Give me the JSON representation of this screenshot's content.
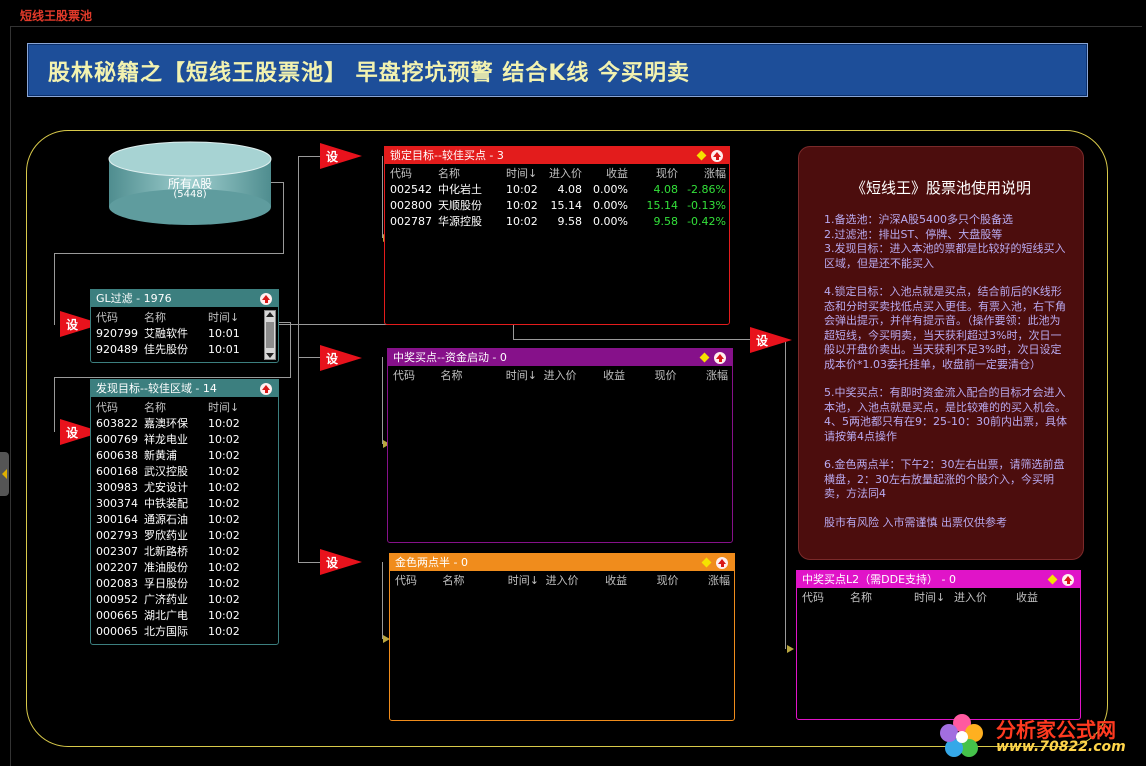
{
  "app": {
    "title": "短线王股票池"
  },
  "banner": {
    "title": "股林秘籍之【短线王股票池】 早盘挖坑预警 结合K线 今买明卖"
  },
  "flag_label": "设",
  "all_stocks": {
    "label": "所有A股",
    "count": "(5448)"
  },
  "gl_filter": {
    "title": "GL过滤 - 1976",
    "headers": [
      "代码",
      "名称",
      "时间↓"
    ],
    "rows": [
      {
        "code": "920799",
        "name": "艾融软件",
        "time": "10:01"
      },
      {
        "code": "920489",
        "name": "佳先股份",
        "time": "10:01"
      }
    ]
  },
  "discover": {
    "title": "发现目标--较佳区域 - 14",
    "headers": [
      "代码",
      "名称",
      "时间↓"
    ],
    "rows": [
      {
        "code": "603822",
        "name": "嘉澳环保",
        "time": "10:02"
      },
      {
        "code": "600769",
        "name": "祥龙电业",
        "time": "10:02"
      },
      {
        "code": "600638",
        "name": "新黄浦",
        "time": "10:02"
      },
      {
        "code": "600168",
        "name": "武汉控股",
        "time": "10:02"
      },
      {
        "code": "300983",
        "name": "尤安设计",
        "time": "10:02"
      },
      {
        "code": "300374",
        "name": "中铁装配",
        "time": "10:02"
      },
      {
        "code": "300164",
        "name": "通源石油",
        "time": "10:02"
      },
      {
        "code": "002793",
        "name": "罗欣药业",
        "time": "10:02"
      },
      {
        "code": "002307",
        "name": "北新路桥",
        "time": "10:02"
      },
      {
        "code": "002207",
        "name": "准油股份",
        "time": "10:02"
      },
      {
        "code": "002083",
        "name": "孚日股份",
        "time": "10:02"
      },
      {
        "code": "000952",
        "name": "广济药业",
        "time": "10:02"
      },
      {
        "code": "000665",
        "name": "湖北广电",
        "time": "10:02"
      },
      {
        "code": "000065",
        "name": "北方国际",
        "time": "10:02"
      }
    ]
  },
  "locked": {
    "title": "锁定目标--较佳买点 - 3",
    "headers": [
      "代码",
      "名称",
      "时间↓",
      "进入价",
      "收益",
      "现价",
      "涨幅"
    ],
    "rows": [
      {
        "code": "002542",
        "name": "中化岩土",
        "time": "10:02",
        "entry": "4.08",
        "gain": "0.00%",
        "price": "4.08",
        "chg": "-2.86%"
      },
      {
        "code": "002800",
        "name": "天顺股份",
        "time": "10:02",
        "entry": "15.14",
        "gain": "0.00%",
        "price": "15.14",
        "chg": "-0.13%"
      },
      {
        "code": "002787",
        "name": "华源控股",
        "time": "10:02",
        "entry": "9.58",
        "gain": "0.00%",
        "price": "9.58",
        "chg": "-0.42%"
      }
    ]
  },
  "mid_buy": {
    "title": "中奖买点--资金启动 - 0",
    "headers": [
      "代码",
      "名称",
      "时间↓",
      "进入价",
      "收益",
      "现价",
      "涨幅"
    ]
  },
  "golden": {
    "title": "金色两点半 - 0",
    "headers": [
      "代码",
      "名称",
      "时间↓",
      "进入价",
      "收益",
      "现价",
      "涨幅"
    ]
  },
  "l2": {
    "title": "中奖买点L2（需DDE支持） - 0",
    "headers": [
      "代码",
      "名称",
      "时间↓",
      "进入价",
      "收益"
    ]
  },
  "info": {
    "title": "《短线王》股票池使用说明",
    "paragraphs": [
      "1.备选池：沪深A股5400多只个股备选\n2.过滤池：排出ST、停牌、大盘股等\n3.发现目标：进入本池的票都是比较好的短线买入区域，但是还不能买入",
      "4.锁定目标：入池点就是买点，结合前后的K线形态和分时买卖找低点买入更佳。有票入池，右下角会弹出提示，并伴有提示音。（操作要领：此池为超短线，今买明卖，当天获利超过3%时，次日一般以开盘价卖出。当天获利不足3%时，次日设定成本价*1.03委托挂单，收盘前一定要清仓）",
      "5.中奖买点：有即时资金流入配合的目标才会进入本池，入池点就是买点，是比较难的的买入机会。4、5两池都只有在9：25-10：30前内出票，具体请按第4点操作",
      "6.金色两点半：下午2：30左右出票，请筛选前盘横盘，2：30左右放量起涨的个股介入，今买明卖，方法同4",
      "股市有风险 入市需谨慎 出票仅供参考"
    ]
  },
  "logo": {
    "name": "分析家公式网",
    "url": "www.70822.com"
  },
  "colors": {
    "banner_bg": "#1d4e99",
    "locked_header": "#e31c1c",
    "mid_header": "#86118a",
    "golden_header": "#f08c1c",
    "l2_header": "#e014c8",
    "teal_header": "#3c7f7f",
    "frame": "#d8c94a",
    "info_bg": "#4c0d0d"
  },
  "icons": [
    "flag-icon",
    "diamond-icon",
    "up-arrow-icon",
    "scroll-up-icon",
    "scroll-down-icon",
    "logo-flower-icon"
  ]
}
